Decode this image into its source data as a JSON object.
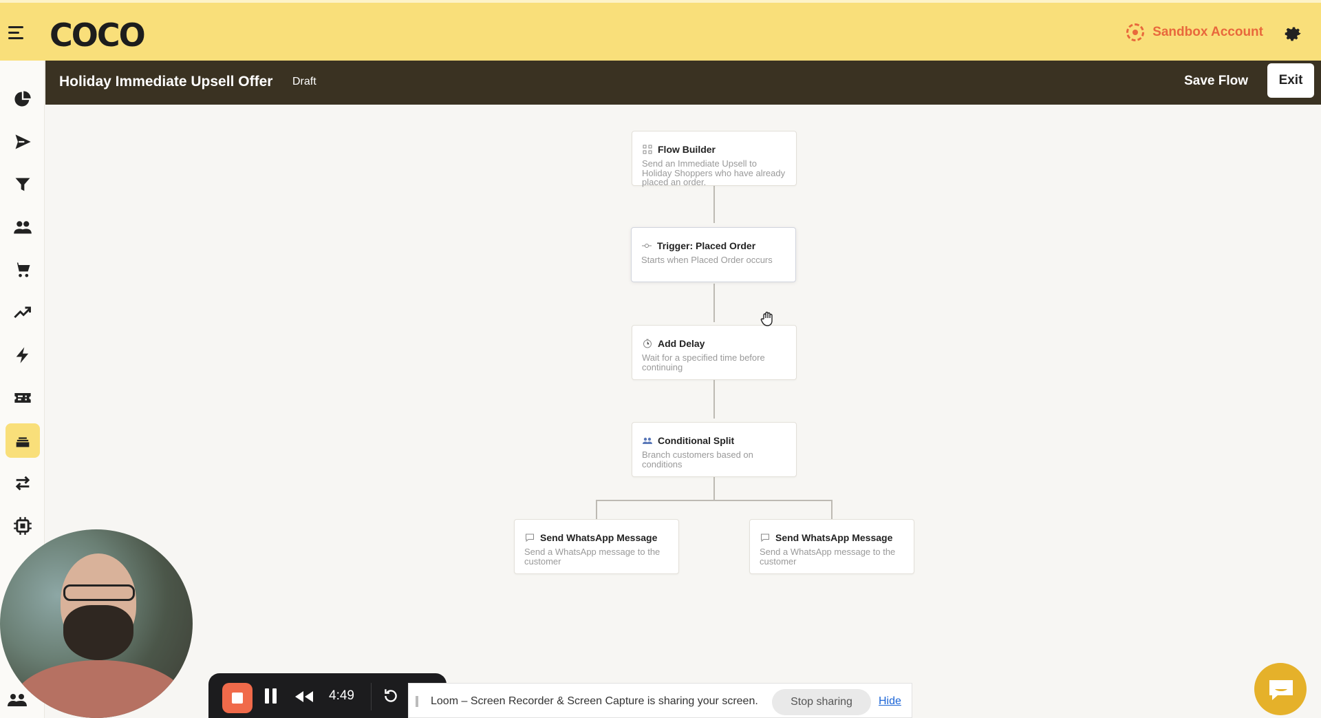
{
  "brand": {
    "logo": "COCO",
    "account_label": "Sandbox Account",
    "accent": "#f9df7a",
    "account_color": "#e8683c"
  },
  "sidebar": {
    "items": [
      {
        "icon": "pie-chart-icon",
        "active": false
      },
      {
        "icon": "send-icon",
        "active": false
      },
      {
        "icon": "funnel-icon",
        "active": false
      },
      {
        "icon": "users-icon",
        "active": false
      },
      {
        "icon": "cart-icon",
        "active": false
      },
      {
        "icon": "trending-up-icon",
        "active": false
      },
      {
        "icon": "lightning-icon",
        "active": false
      },
      {
        "icon": "ticket-icon",
        "active": false
      },
      {
        "icon": "stack-icon",
        "active": true
      },
      {
        "icon": "swap-icon",
        "active": false
      },
      {
        "icon": "chip-icon",
        "active": false
      }
    ]
  },
  "header": {
    "title": "Holiday Immediate Upsell Offer",
    "status": "Draft",
    "save_label": "Save Flow",
    "exit_label": "Exit",
    "bg": "#3a3222"
  },
  "flow": {
    "nodes": [
      {
        "title": "Flow Builder",
        "description": "Send an Immediate Upsell to Holiday Shoppers who have already placed an order.",
        "icon": "flow-icon"
      },
      {
        "title": "Trigger: Placed Order",
        "description": "Starts when Placed Order occurs",
        "icon": "trigger-icon"
      },
      {
        "title": "Add Delay",
        "description": "Wait for a specified time before continuing",
        "icon": "clock-icon"
      },
      {
        "title": "Conditional Split",
        "description": "Branch customers based on conditions",
        "icon": "split-icon"
      },
      {
        "title": "Send WhatsApp Message",
        "description": "Send a WhatsApp message to the customer",
        "icon": "chat-bubble-icon"
      },
      {
        "title": "Send WhatsApp Message",
        "description": "Send a WhatsApp message to the customer",
        "icon": "chat-bubble-icon"
      }
    ]
  },
  "recorder": {
    "time": "4:49",
    "stop_color": "#f06a4a"
  },
  "share_bar": {
    "message": "Loom – Screen Recorder & Screen Capture is sharing your screen.",
    "stop_label": "Stop sharing",
    "hide_label": "Hide"
  },
  "chat": {
    "icon": "chat-icon",
    "color": "#e5b12a"
  }
}
